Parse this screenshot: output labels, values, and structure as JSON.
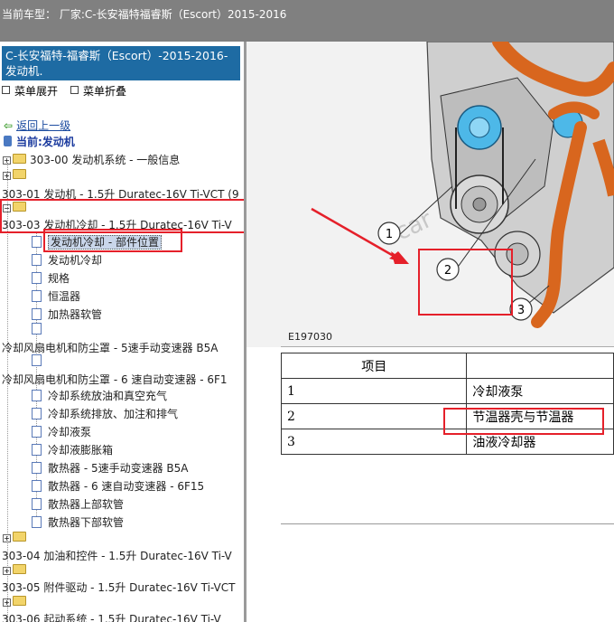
{
  "topbar": {
    "title": "当前车型：  厂家:C-长安福特福睿斯（Escort）2015-2016"
  },
  "sidebar": {
    "breadcrumb": "C-长安福特-福睿斯（Escort）-2015-2016- 发动机.",
    "expand_label": "菜单展开",
    "collapse_label": "菜单折叠",
    "back_label": "返回上一级",
    "current_label": "当前:发动机",
    "tree": [
      {
        "label": "303-00 发动机系统 - 一般信息"
      },
      {
        "label": "303-01 发动机 - 1.5升 Duratec-16V Ti-VCT (9"
      },
      {
        "label": "303-03 发动机冷却 - 1.5升 Duratec-16V Ti-V"
      },
      {
        "label": "发动机冷却 - 部件位置"
      },
      {
        "label": "发动机冷却"
      },
      {
        "label": "规格"
      },
      {
        "label": "恒温器"
      },
      {
        "label": "加热器软管"
      },
      {
        "label": "冷却风扇电机和防尘罩 - 5速手动变速器 B5A"
      },
      {
        "label": "冷却风扇电机和防尘罩 - 6 速自动变速器 - 6F1"
      },
      {
        "label": "冷却系统放油和真空充气"
      },
      {
        "label": "冷却系统排放、加注和排气"
      },
      {
        "label": "冷却液泵"
      },
      {
        "label": "冷却液膨胀箱"
      },
      {
        "label": "散热器 - 5速手动变速器 B5A"
      },
      {
        "label": "散热器 - 6 速自动变速器 - 6F15"
      },
      {
        "label": "散热器上部软管"
      },
      {
        "label": "散热器下部软管"
      },
      {
        "label": "303-04 加油和控件 - 1.5升 Duratec-16V Ti-V"
      },
      {
        "label": "303-05 附件驱动 - 1.5升 Duratec-16V Ti-VCT"
      },
      {
        "label": "303-06 起动系统 - 1.5升 Duratec-16V Ti-V"
      }
    ]
  },
  "figure": {
    "code": "E197030",
    "callouts": [
      "1",
      "2",
      "3"
    ],
    "watermark": "car"
  },
  "table": {
    "header": "项目",
    "rows": [
      {
        "num": "1",
        "name": "冷却液泵"
      },
      {
        "num": "2",
        "name": "节温器壳与节温器"
      },
      {
        "num": "3",
        "name": "油液冷却器"
      }
    ]
  },
  "colors": {
    "accent": "#1e6ba3",
    "highlight": "#e5202a",
    "hose": "#d8661e"
  }
}
